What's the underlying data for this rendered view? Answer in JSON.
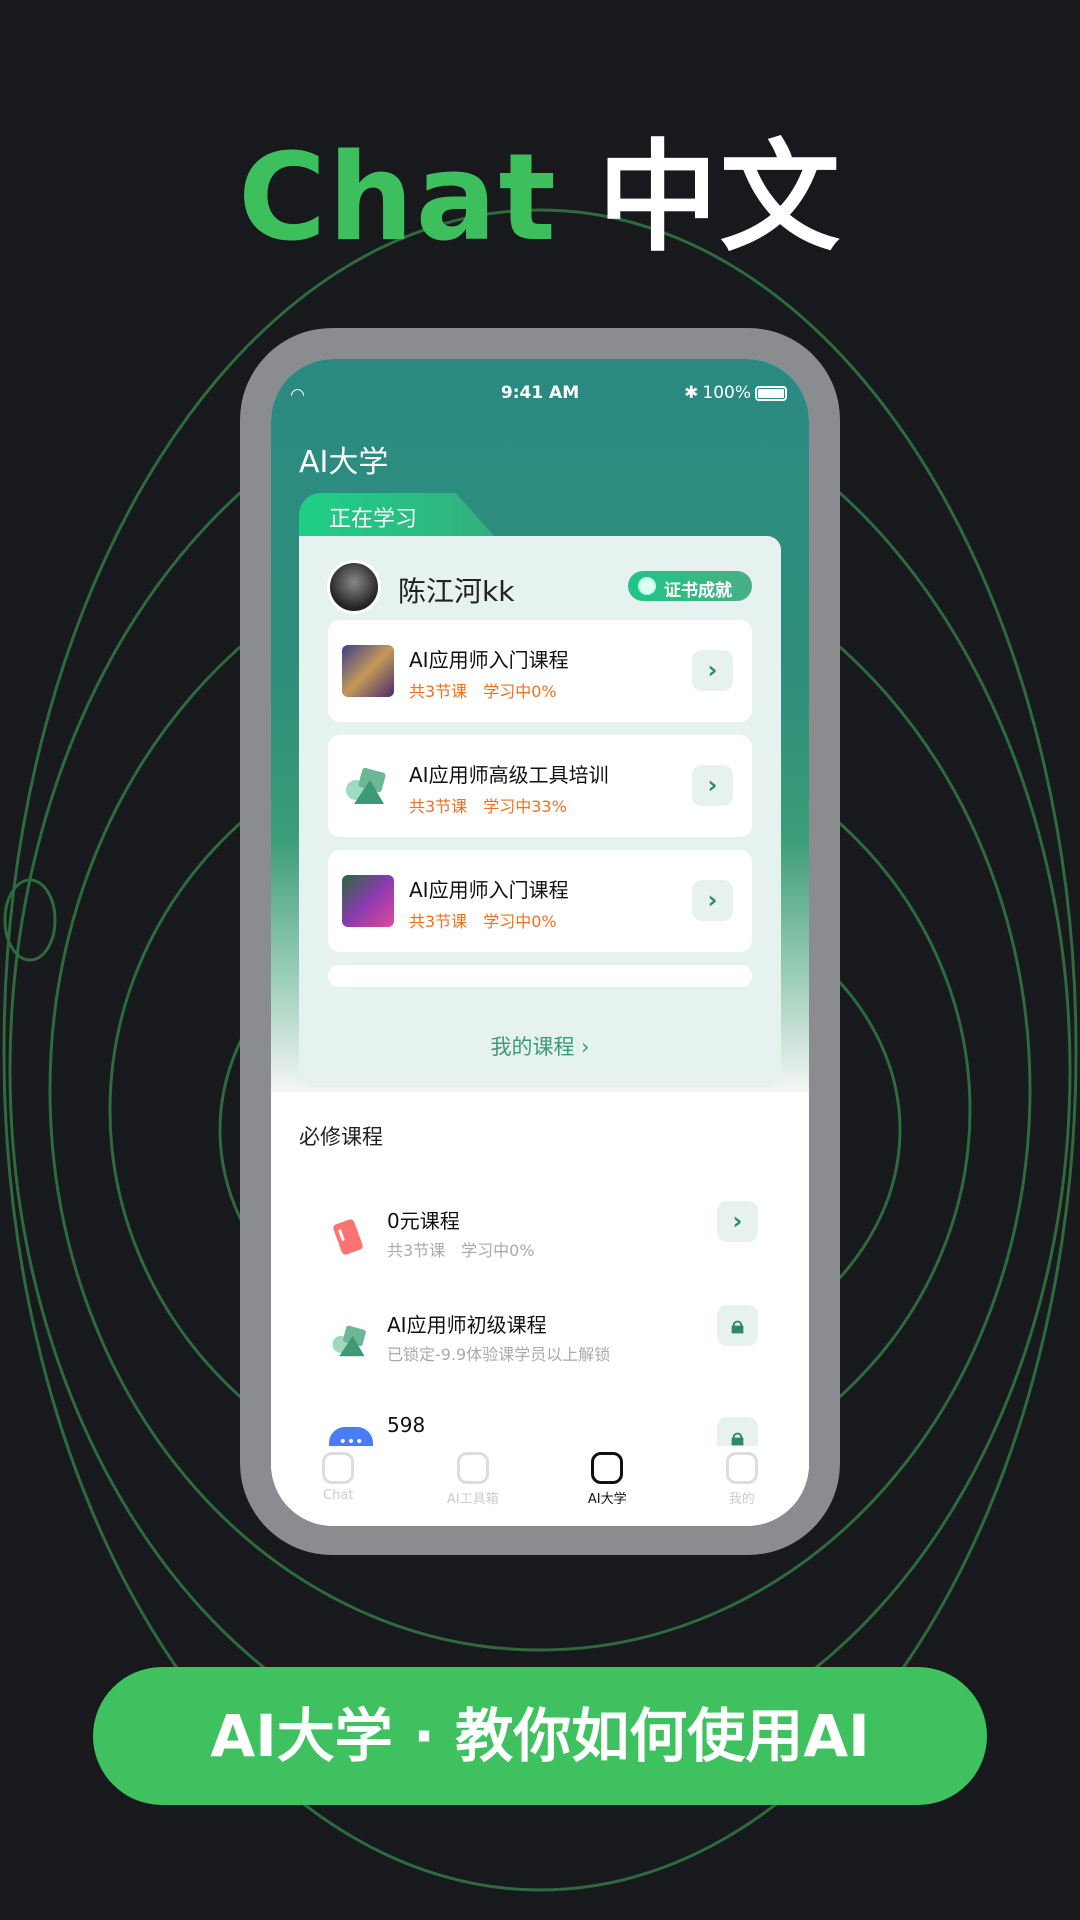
{
  "hero": {
    "title_latin": "Chat",
    "title_cn": "中文"
  },
  "status_bar": {
    "time": "9:41 AM",
    "battery": "100%"
  },
  "app": {
    "title": "AI大学"
  },
  "learning": {
    "tab_label": "正在学习",
    "user_name": "陈江河kk",
    "cert_label": "证书成就",
    "courses": [
      {
        "title": "AI应用师入门课程",
        "lessons": "共3节课",
        "progress": "学习中0%"
      },
      {
        "title": "AI应用师高级工具培训",
        "lessons": "共3节课",
        "progress": "学习中33%"
      },
      {
        "title": "AI应用师入门课程",
        "lessons": "共3节课",
        "progress": "学习中0%"
      }
    ],
    "more_label": "我的课程 ›"
  },
  "required": {
    "title": "必修课程",
    "items": [
      {
        "title": "0元课程",
        "subtitle": "共3节课　学习中0%",
        "action": "arrow"
      },
      {
        "title": "AI应用师初级课程",
        "subtitle": "已锁定-9.9体验课学员以上解锁",
        "action": "lock"
      },
      {
        "title": "598",
        "subtitle": "",
        "action": "lock"
      }
    ]
  },
  "tabbar": {
    "items": [
      {
        "label": "Chat"
      },
      {
        "label": "AI工具箱"
      },
      {
        "label": "AI大学",
        "active": true
      },
      {
        "label": "我的"
      }
    ]
  },
  "banner": {
    "text": "AI大学 · 教你如何使用AI"
  },
  "colors": {
    "brand_green": "#3fc160",
    "accent_orange": "#f07020",
    "teal": "#2a8a82",
    "background": "#17191c"
  }
}
